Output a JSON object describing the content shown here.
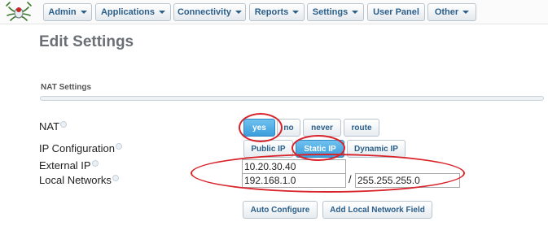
{
  "nav": {
    "items": [
      {
        "label": "Admin",
        "dropdown": true
      },
      {
        "label": "Applications",
        "dropdown": true
      },
      {
        "label": "Connectivity",
        "dropdown": true
      },
      {
        "label": "Reports",
        "dropdown": true
      },
      {
        "label": "Settings",
        "dropdown": true
      },
      {
        "label": "User Panel",
        "dropdown": false
      },
      {
        "label": "Other",
        "dropdown": true
      }
    ]
  },
  "page": {
    "title": "Edit Settings"
  },
  "section": {
    "title": "NAT Settings"
  },
  "form": {
    "nat": {
      "label": "NAT",
      "options": [
        "yes",
        "no",
        "never",
        "route"
      ],
      "selected": "yes"
    },
    "ip_config": {
      "label": "IP Configuration",
      "options": [
        "Public IP",
        "Static IP",
        "Dynamic IP"
      ],
      "selected": "Static IP"
    },
    "external_ip": {
      "label": "External IP",
      "value": "10.20.30.40"
    },
    "local_networks": {
      "label": "Local Networks",
      "network": "192.168.1.0",
      "separator": "/",
      "netmask": "255.255.255.0"
    }
  },
  "actions": {
    "auto_configure": "Auto Configure",
    "add_local_network_field": "Add Local Network Field"
  },
  "colors": {
    "accent": "#3b9ddc",
    "annotation": "#d8232a",
    "link_text": "#2b5f8a"
  }
}
